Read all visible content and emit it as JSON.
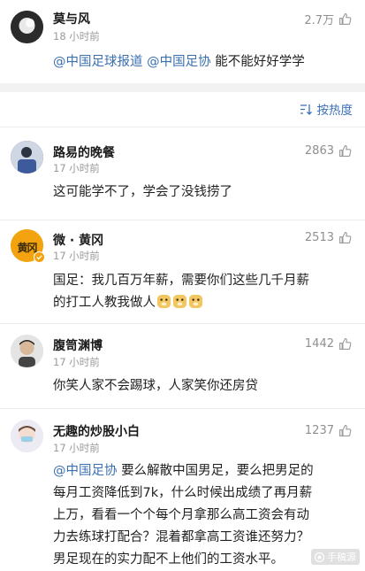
{
  "top_comment": {
    "username": "莫与风",
    "time": "18 小时前",
    "likes": "2.7万",
    "mention1": "@中国足球报道",
    "mention2": "@中国足协",
    "text": "能不能好好学学"
  },
  "sort": {
    "label": "按热度",
    "icon": "sort-icon"
  },
  "comments": [
    {
      "username": "路易的晚餐",
      "time": "17 小时前",
      "likes": "2863",
      "text": "这可能学不了，学会了没钱捞了"
    },
    {
      "username": "微 · 黄冈",
      "time": "17 小时前",
      "likes": "2513",
      "avatar_text": "黄冈",
      "line1": "国足：我几百万年薪，需要你们这些几千月薪",
      "line2": "的打工人教我做人"
    },
    {
      "username": "腹笥渊博",
      "time": "17 小时前",
      "likes": "1442",
      "text": "你笑人家不会踢球，人家笑你还房贷"
    },
    {
      "username": "无趣的炒股小白",
      "time": "17 小时前",
      "likes": "1237",
      "mention": "@中国足协",
      "line1": "要么解散中国男足，要么把男足的",
      "line2": "每月工资降低到7k，什么时候出成绩了再月薪",
      "line3": "上万，看看一个个每个月拿那么高工资会有动",
      "line4": "力去练球打配合？混着都拿高工资谁还努力？",
      "line5": "男足现在的实力配不上他们的工资水平。"
    }
  ],
  "watermark": {
    "text": "手稿源"
  },
  "colors": {
    "mention": "#3a6fb0",
    "accent": "#3b6fb6",
    "badge": "#f2a30f"
  }
}
